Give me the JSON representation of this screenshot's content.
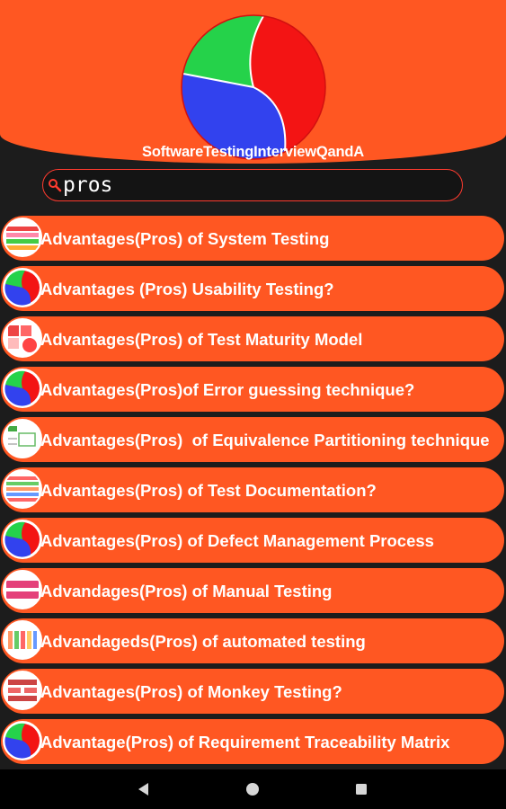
{
  "app": {
    "title": "SoftwareTestingInterviewQandA"
  },
  "colors": {
    "accent": "#ff5722",
    "background": "#1c1c1c",
    "search_border": "#ff3b2f",
    "text": "#ffffff"
  },
  "search": {
    "value": "pros",
    "icon": "search-icon"
  },
  "results": [
    {
      "label": "Advantages(Pros) of System Testing",
      "thumb": "chart-thumbnail"
    },
    {
      "label": "Advantages (Pros) Usability Testing?",
      "thumb": "app-logo-thumbnail"
    },
    {
      "label": "Advantages(Pros) of Test Maturity Model",
      "thumb": "puzzle-thumbnail"
    },
    {
      "label": "Advantages(Pros)of Error guessing technique?",
      "thumb": "app-logo-thumbnail"
    },
    {
      "label": "Advantages(Pros)  of Equivalence Partitioning technique",
      "thumb": "diagram-thumbnail"
    },
    {
      "label": "Advantages(Pros) of Test Documentation?",
      "thumb": "stripes-thumbnail"
    },
    {
      "label": "Advantages(Pros) of Defect Management Process",
      "thumb": "app-logo-thumbnail"
    },
    {
      "label": "Advandages(Pros) of Manual Testing",
      "thumb": "slide-thumbnail"
    },
    {
      "label": "Advandageds(Pros) of automated testing",
      "thumb": "blocks-thumbnail"
    },
    {
      "label": "Advantages(Pros) of Monkey Testing?",
      "thumb": "table-thumbnail"
    },
    {
      "label": "Advantage(Pros) of Requirement Traceability Matrix",
      "thumb": "app-logo-thumbnail"
    }
  ],
  "navbar": {
    "back": "back-triangle-icon",
    "home": "home-circle-icon",
    "recents": "recents-square-icon"
  }
}
